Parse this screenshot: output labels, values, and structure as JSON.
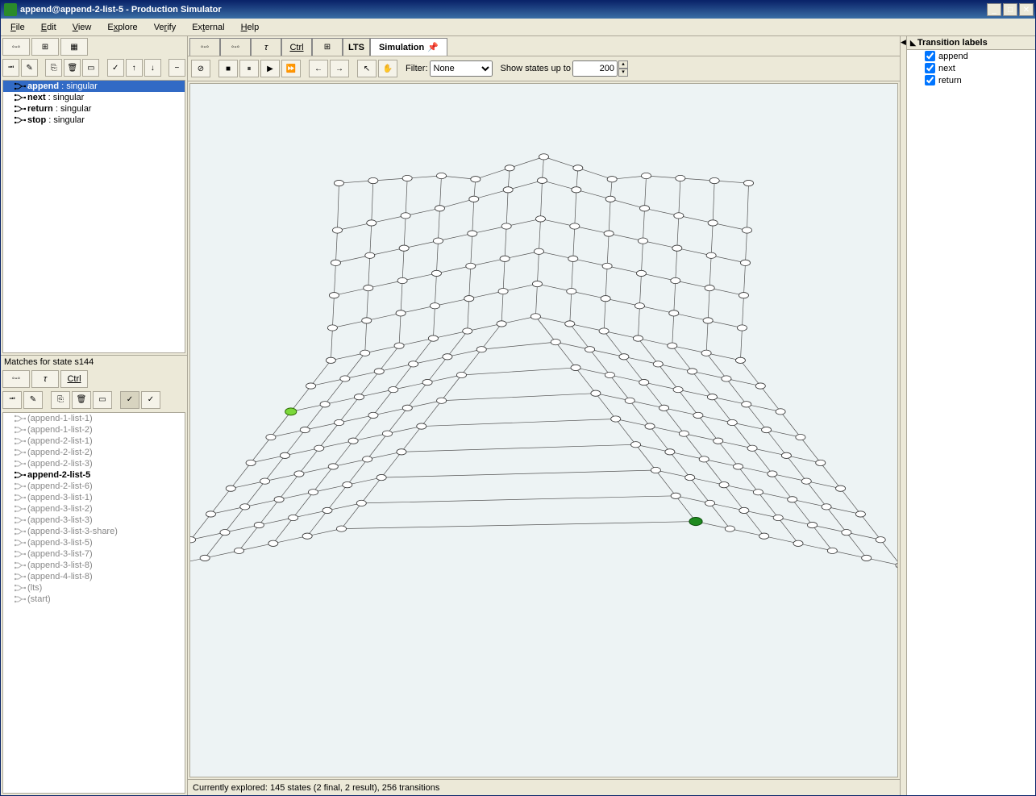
{
  "window": {
    "title": "append@append-2-list-5 - Production Simulator"
  },
  "menu": {
    "file": "File",
    "edit": "Edit",
    "view": "View",
    "explore": "Explore",
    "verify": "Verify",
    "external": "External",
    "help": "Help"
  },
  "upper_tree": {
    "items": [
      {
        "label": "append",
        "suffix": " : singular",
        "selected": true
      },
      {
        "label": "next",
        "suffix": " : singular",
        "selected": false
      },
      {
        "label": "return",
        "suffix": " : singular",
        "selected": false
      },
      {
        "label": "stop",
        "suffix": " : singular",
        "selected": false
      }
    ]
  },
  "matches": {
    "header": "Matches for state s144",
    "items": [
      "(append-1-list-1)",
      "(append-1-list-2)",
      "(append-2-list-1)",
      "(append-2-list-2)",
      "(append-2-list-3)",
      "append-2-list-5",
      "(append-2-list-6)",
      "(append-3-list-1)",
      "(append-3-list-2)",
      "(append-3-list-3)",
      "(append-3-list-3-share)",
      "(append-3-list-5)",
      "(append-3-list-7)",
      "(append-3-list-8)",
      "(append-4-list-8)",
      "(lts)",
      "(start)"
    ],
    "active_index": 5
  },
  "tabs": {
    "lts_label": "LTS",
    "sim_label": "Simulation"
  },
  "sim_toolbar": {
    "filter_label": "Filter:",
    "filter_value": "None",
    "show_states_label": "Show states up to",
    "show_states_value": "200"
  },
  "status": {
    "text": "Currently explored: 145 states (2 final, 2 result), 256 transitions"
  },
  "right_panel": {
    "header": "Transition labels",
    "items": [
      {
        "label": "append",
        "checked": true
      },
      {
        "label": "next",
        "checked": true
      },
      {
        "label": "return",
        "checked": true
      }
    ]
  }
}
